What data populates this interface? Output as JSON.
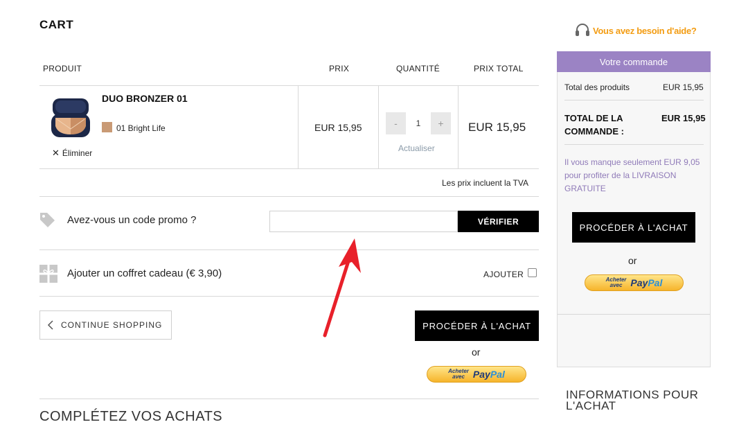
{
  "cart": {
    "title": "CART",
    "columns": [
      "PRODUIT",
      "PRIX",
      "QUANTITÉ",
      "PRIX TOTAL"
    ],
    "item": {
      "name": "DUO BRONZER 01",
      "variant": "01 Bright Life",
      "variant_color": "#c99a75",
      "remove_label": "Éliminer",
      "price": "EUR 15,95",
      "quantity": "1",
      "qty_minus": "-",
      "qty_plus": "+",
      "update_label": "Actualiser",
      "total": "EUR 15,95"
    },
    "tax_note": "Les prix incluent la TVA"
  },
  "promo": {
    "label": "Avez-vous un code promo ?",
    "input_value": "",
    "verify_label": "VÉRIFIER"
  },
  "gift": {
    "label": "Ajouter un coffret cadeau (€ 3,90)",
    "add_label": "AJOUTER",
    "checked": false
  },
  "actions": {
    "continue_label": "CONTINUE SHOPPING",
    "checkout_label": "PROCÉDER À L'ACHAT",
    "or_label": "or",
    "paypal_small_1": "Acheter",
    "paypal_small_2": "avec",
    "paypal_pay": "Pay",
    "paypal_pal": "Pal"
  },
  "complete_title": "COMPLÉTEZ VOS ACHATS",
  "help": {
    "label": "Vous avez besoin d'aide?"
  },
  "order": {
    "header": "Votre commande",
    "subtotal_label": "Total des produits",
    "subtotal_value": "EUR 15,95",
    "total_label": "TOTAL DE LA COMMANDE :",
    "total_value": "EUR 15,95",
    "shipping_note": "Il vous manque seulement EUR 9,05 pour profiter de la LIVRAISON GRATUITE",
    "checkout_label": "PROCÉDER À L'ACHAT",
    "or_label": "or"
  },
  "info_title": "INFORMATIONS POUR L'ACHAT",
  "colors": {
    "accent_purple": "#9b83c4",
    "help_orange": "#f39c12",
    "annotation_arrow": "#e8202a",
    "button_black": "#000000"
  }
}
